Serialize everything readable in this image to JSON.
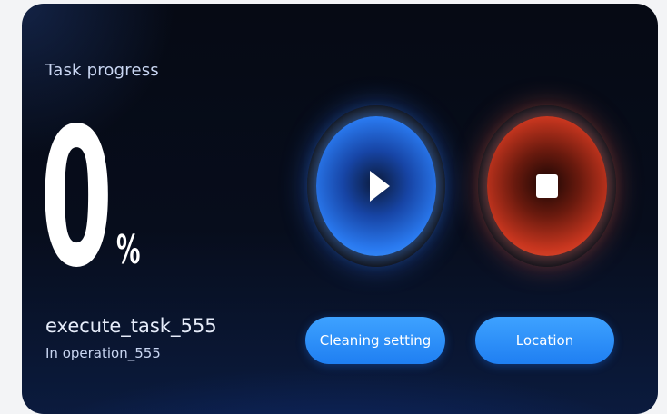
{
  "panel": {
    "title": "Task progress",
    "progress_value": "0",
    "progress_unit": "%",
    "task_name": "execute_task_555",
    "task_status": "In operation_555"
  },
  "controls": {
    "play": {
      "icon": "play-icon",
      "color": "#2a7af0"
    },
    "stop": {
      "icon": "stop-icon",
      "color": "#e8462a"
    }
  },
  "buttons": {
    "cleaning_setting": "Cleaning setting",
    "location": "Location"
  },
  "colors": {
    "background": "#070d1c",
    "accent": "#2f8ff8"
  }
}
